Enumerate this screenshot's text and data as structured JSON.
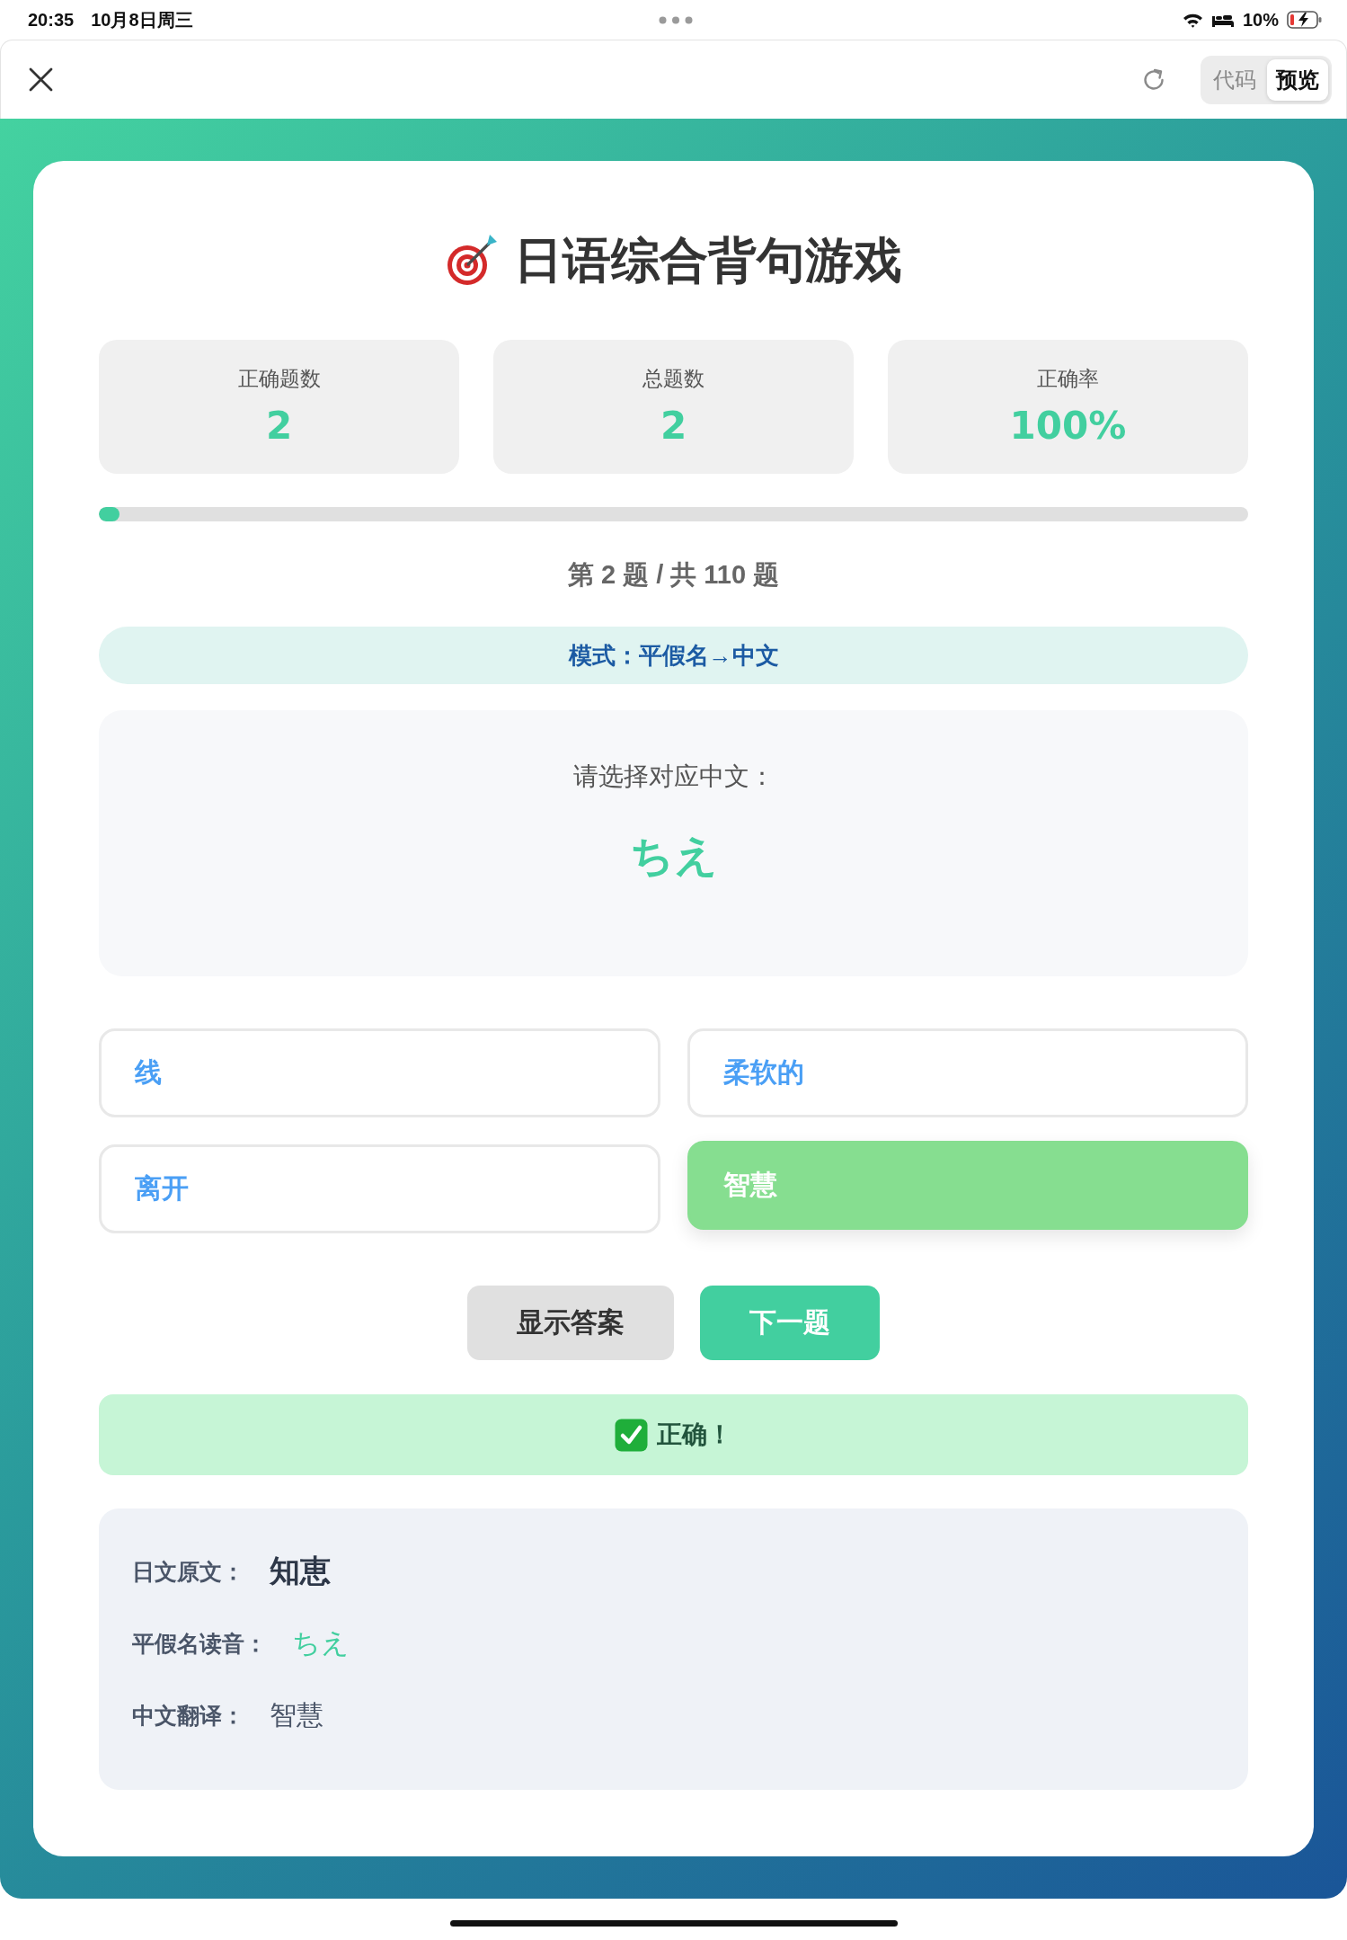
{
  "status_bar": {
    "time": "20:35",
    "date": "10月8日周三",
    "battery": "10%"
  },
  "toolbar": {
    "tabs": [
      {
        "label": "代码",
        "selected": false
      },
      {
        "label": "预览",
        "selected": true
      }
    ]
  },
  "game": {
    "title": "日语综合背句游戏",
    "stats": [
      {
        "label": "正确题数",
        "value": "2"
      },
      {
        "label": "总题数",
        "value": "2"
      },
      {
        "label": "正确率",
        "value": "100%"
      }
    ],
    "progress": {
      "level": 0.018
    },
    "counter": "第 2 题 / 共 110 题",
    "mode": "模式：平假名→中文",
    "question": {
      "prompt": "请选择对应中文：",
      "word": "ちえ"
    },
    "options": [
      {
        "label": "线",
        "selected": false
      },
      {
        "label": "柔软的",
        "selected": false
      },
      {
        "label": "离开",
        "selected": false
      },
      {
        "label": "智慧",
        "selected": true
      }
    ],
    "buttons": [
      {
        "label": "显示答案",
        "kind": "secondary"
      },
      {
        "label": "下一题",
        "kind": "primary"
      }
    ],
    "feedback": {
      "text": "正确！",
      "correct": true
    },
    "details": [
      {
        "label": "日文原文：",
        "value": "知恵",
        "kind": "original"
      },
      {
        "label": "平假名读音：",
        "value": "ちえ",
        "kind": "reading"
      },
      {
        "label": "中文翻译：",
        "value": "智慧",
        "kind": "translation"
      }
    ]
  }
}
